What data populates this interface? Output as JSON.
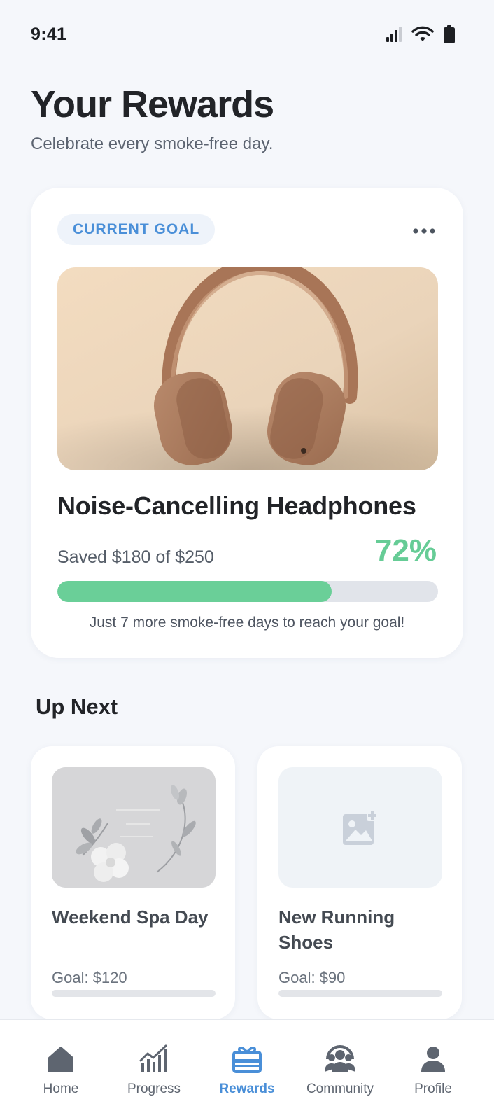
{
  "status_bar": {
    "time": "9:41",
    "icons": [
      "cellular-signal-icon",
      "wifi-icon",
      "battery-icon"
    ]
  },
  "header": {
    "title": "Your Rewards",
    "subtitle": "Celebrate every smoke-free day."
  },
  "current_goal": {
    "badge": "CURRENT GOAL",
    "menu_icon": "more-horizontal-icon",
    "image": "headphones-photo",
    "name": "Noise-Cancelling Headphones",
    "saved_text": "Saved $180 of $250",
    "percent_text": "72%",
    "progress": 0.72,
    "note": "Just 7 more smoke-free days to reach your goal!"
  },
  "up_next": {
    "title": "Up Next",
    "items": [
      {
        "name": "Weekend Spa Day",
        "goal": "Goal: $120",
        "image": "spa-gift-card-photo",
        "progress": 0
      },
      {
        "name": "New Running Shoes",
        "goal": "Goal: $90",
        "image": "add-image-icon",
        "progress": 0
      }
    ]
  },
  "tab_bar": {
    "active": "Rewards",
    "tabs": [
      {
        "label": "Home",
        "icon": "home-icon"
      },
      {
        "label": "Progress",
        "icon": "chart-icon"
      },
      {
        "label": "Rewards",
        "icon": "gift-icon"
      },
      {
        "label": "Community",
        "icon": "group-icon"
      },
      {
        "label": "Profile",
        "icon": "person-icon"
      }
    ]
  },
  "colors": {
    "accent_blue": "#4a8fd8",
    "progress_green": "#6acf98",
    "background": "#f5f7fb",
    "inactive_gray": "#5e6570"
  }
}
